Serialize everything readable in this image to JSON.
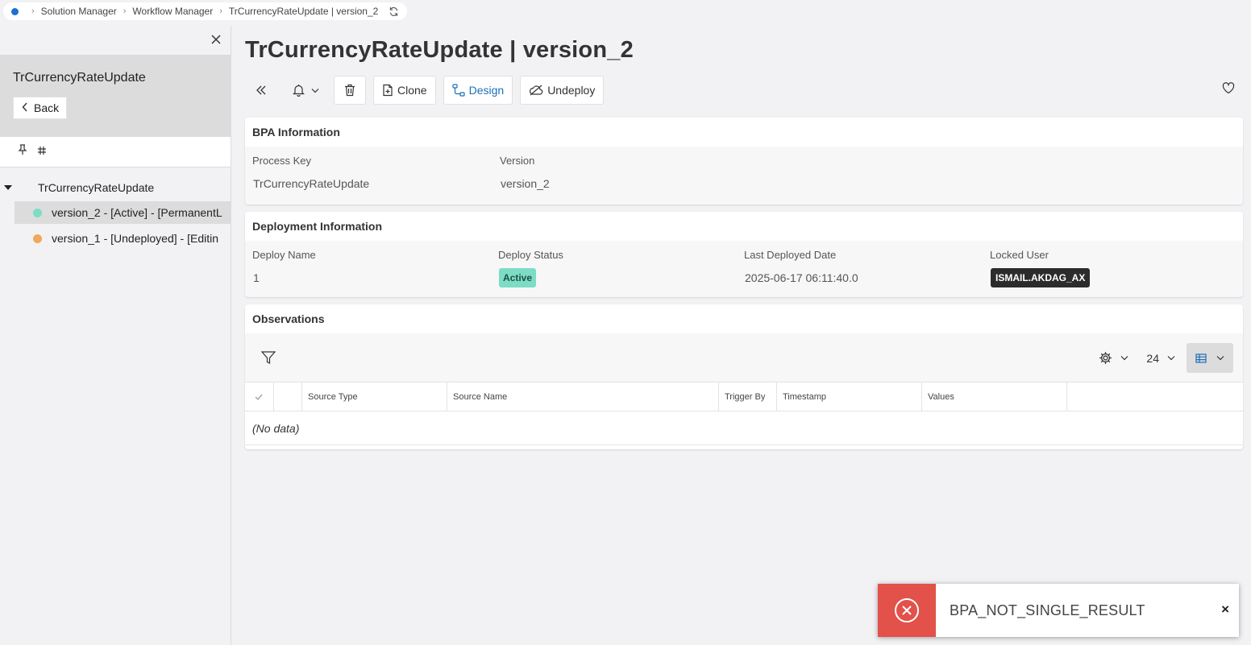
{
  "breadcrumb": {
    "items": [
      "Solution Manager",
      "Workflow Manager",
      "TrCurrencyRateUpdate | version_2"
    ],
    "separator": ">"
  },
  "sidebar": {
    "title": "TrCurrencyRateUpdate",
    "back_label": "Back",
    "tree": {
      "root_label": "TrCurrencyRateUpdate",
      "items": [
        {
          "label": "version_2 - [Active] - [PermanentL",
          "status_color": "#7ddcc6"
        },
        {
          "label": "version_1 - [Undeployed] - [Editin",
          "status_color": "#f0a95a"
        }
      ]
    }
  },
  "main": {
    "title": "TrCurrencyRateUpdate | version_2",
    "toolbar": {
      "clone_label": "Clone",
      "design_label": "Design",
      "undeploy_label": "Undeploy"
    },
    "bpa": {
      "title": "BPA Information",
      "process_key_label": "Process Key",
      "process_key_value": "TrCurrencyRateUpdate",
      "version_label": "Version",
      "version_value": "version_2"
    },
    "deployment": {
      "title": "Deployment Information",
      "deploy_name_label": "Deploy Name",
      "deploy_name_value": "1",
      "deploy_status_label": "Deploy Status",
      "deploy_status_value": "Active",
      "last_deployed_label": "Last Deployed Date",
      "last_deployed_value": "2025-06-17 06:11:40.0",
      "locked_user_label": "Locked User",
      "locked_user_value": "ISMAIL.AKDAG_AX"
    },
    "observations": {
      "title": "Observations",
      "page_size": "24",
      "columns": [
        "Source Type",
        "Source Name",
        "Trigger By",
        "Timestamp",
        "Values"
      ],
      "empty_text": "(No data)"
    }
  },
  "toast": {
    "message": "BPA_NOT_SINGLE_RESULT",
    "close_label": "×",
    "accent_color": "#e2514a"
  },
  "colors": {
    "brand": "#1e6fd0",
    "design_text": "#1d6fb8",
    "active_badge": "#7ddcc6",
    "user_badge": "#2c2c2c"
  }
}
